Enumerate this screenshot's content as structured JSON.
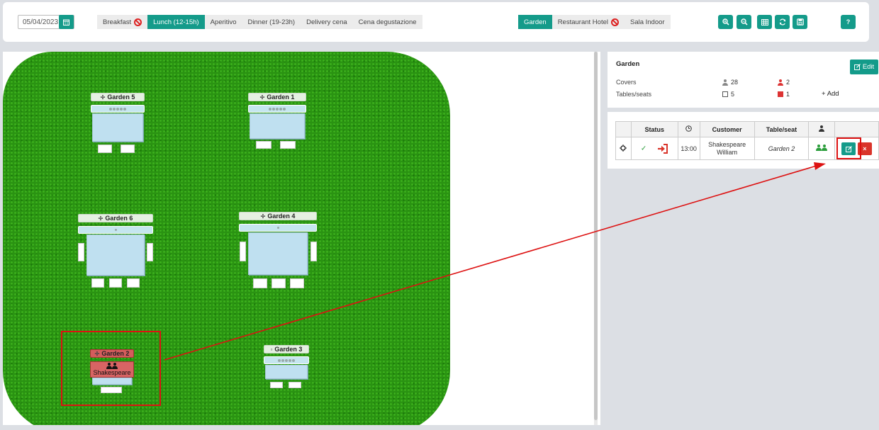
{
  "toolbar": {
    "date_value": "05/04/2023",
    "services": [
      {
        "label": "Breakfast",
        "active": false,
        "disabled": true
      },
      {
        "label": "Lunch (12-15h)",
        "active": true,
        "disabled": false
      },
      {
        "label": "Aperitivo",
        "active": false,
        "disabled": false
      },
      {
        "label": "Dinner (19-23h)",
        "active": false,
        "disabled": false
      },
      {
        "label": "Delivery cena",
        "active": false,
        "disabled": false
      },
      {
        "label": "Cena degustazione",
        "active": false,
        "disabled": false
      }
    ],
    "rooms": [
      {
        "label": "Garden",
        "active": true,
        "disabled": false
      },
      {
        "label": "Restaurant Hotel",
        "active": false,
        "disabled": true
      },
      {
        "label": "Sala Indoor",
        "active": false,
        "disabled": false
      }
    ],
    "tools": [
      "zoom-in-icon",
      "zoom-out-icon",
      "table-grid-icon",
      "refresh-icon",
      "save-icon"
    ],
    "help_label": "?"
  },
  "floor": {
    "tables": {
      "garden5": "Garden 5",
      "garden1": "Garden 1",
      "garden6": "Garden 6",
      "garden4": "Garden 4",
      "garden2": "Garden 2",
      "garden3": "Garden 3"
    },
    "garden2_guest": "Shakespeare"
  },
  "info": {
    "title": "Garden",
    "edit_label": "Edit",
    "covers_label": "Covers",
    "tables_label": "Tables/seats",
    "covers_total": "28",
    "covers_busy": "2",
    "tables_total": "5",
    "tables_busy": "1",
    "add_label": "Add"
  },
  "reservations": {
    "headers": {
      "status": "Status",
      "customer": "Customer",
      "table": "Table/seat"
    },
    "rows": [
      {
        "time": "13:00",
        "customer": "Shakespeare William",
        "table": "Garden 2"
      }
    ]
  },
  "colors": {
    "accent": "#149b8a",
    "danger": "#d9342a",
    "divider": "#f39c12"
  }
}
